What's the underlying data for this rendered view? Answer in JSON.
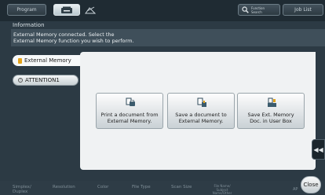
{
  "topbar": {
    "program_label": "Program",
    "function_search_label": "Function\nSearch",
    "job_list_label": "Job List"
  },
  "info": {
    "label": "Information",
    "message": "External Memory connected. Select the\nExternal Memory function you wish to perform."
  },
  "sidetabs": [
    {
      "label": "External Memory"
    },
    {
      "label": "ATTENTION1"
    }
  ],
  "actions": [
    {
      "label": "Print a document from\nExternal Memory."
    },
    {
      "label": "Save a document to\nExternal Memory."
    },
    {
      "label": "Save Ext. Memory\nDoc. in User Box"
    }
  ],
  "bottombar": {
    "simplex": "Simplex/\nDuplex",
    "resolution": "Resolution",
    "color": "Color",
    "file_type": "File Type",
    "scan_size": "Scan Size",
    "file_name": "File Name/\nSubject\nName/Other",
    "ap": "AP",
    "close_label": "Close"
  },
  "colors": {
    "accent_usb": "#e3a21a",
    "panel_bg": "#f0f2f3",
    "dark_bg": "#2c3a44"
  },
  "icons": {
    "copy": "copy-icon",
    "scan": "scan-icon",
    "search": "search-icon",
    "usb": "usb-icon",
    "attention": "attention-icon",
    "print_doc": "print-document-icon",
    "save_doc": "save-document-icon",
    "save_box": "save-box-icon",
    "collapse": "double-chevron-left-icon"
  }
}
